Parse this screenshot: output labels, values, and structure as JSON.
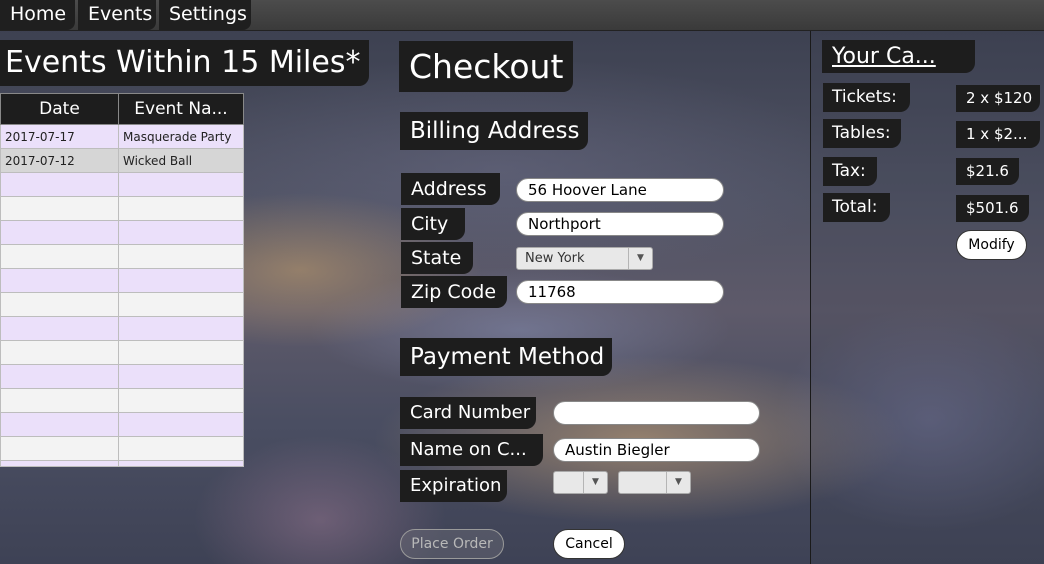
{
  "nav": [
    "Home",
    "Events",
    "Settings"
  ],
  "events_panel": {
    "title": "Events Within 15 Miles*",
    "columns": [
      "Date",
      "Event Na..."
    ],
    "rows": [
      {
        "date": "2017-07-17",
        "name": "Masquerade Party"
      },
      {
        "date": "2017-07-12",
        "name": "Wicked Ball"
      }
    ]
  },
  "checkout": {
    "title": "Checkout",
    "billing": {
      "heading": "Billing Address",
      "address_label": "Address",
      "address_value": "56 Hoover Lane",
      "city_label": "City",
      "city_value": "Northport",
      "state_label": "State",
      "state_value": "New York",
      "zip_label": "Zip Code",
      "zip_value": "11768"
    },
    "payment": {
      "heading": "Payment Method",
      "card_label": "Card Number",
      "card_value": "",
      "name_label": "Name on C...",
      "name_value": "Austin Biegler",
      "expiration_label": "Expiration",
      "exp_month": "",
      "exp_year": ""
    },
    "place_order_label": "Place Order",
    "cancel_label": "Cancel"
  },
  "cart": {
    "title": "Your Ca...",
    "tickets_label": "Tickets:",
    "tickets_value": "2 x $120",
    "tables_label": "Tables:",
    "tables_value": "1 x $2...",
    "tax_label": "Tax:",
    "tax_value": "$21.6",
    "total_label": "Total:",
    "total_value": "$501.6",
    "modify_label": "Modify"
  }
}
